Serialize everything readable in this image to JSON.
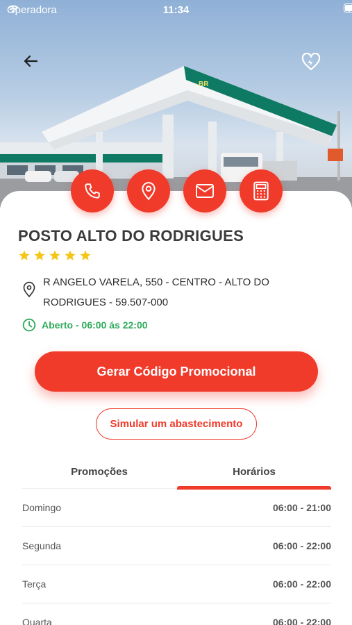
{
  "status_bar": {
    "carrier": "Operadora",
    "time": "11:34"
  },
  "station": {
    "name": "POSTO ALTO DO RODRIGUES",
    "rating": 5,
    "address": "R ANGELO VARELA, 550 - CENTRO - ALTO DO RODRIGUES - 59.507-000",
    "open_hours": "Aberto - 06:00 ás 22:00",
    "canopy_sign": "BR"
  },
  "actions": {
    "promo_button": "Gerar Código Promocional",
    "simulate_button": "Simular um abastecimento"
  },
  "tabs": [
    {
      "label": "Promoções",
      "active": false
    },
    {
      "label": "Horários",
      "active": true
    }
  ],
  "schedule": [
    {
      "day": "Domingo",
      "hours": "06:00 - 21:00"
    },
    {
      "day": "Segunda",
      "hours": "06:00 - 22:00"
    },
    {
      "day": "Terça",
      "hours": "06:00 - 22:00"
    },
    {
      "day": "Quarta",
      "hours": "06:00 - 22:00"
    }
  ],
  "colors": {
    "accent": "#f03a2a",
    "open": "#2eab5a",
    "text": "#3a3a3a"
  },
  "icons": [
    "back-arrow-icon",
    "heart-icon",
    "phone-icon",
    "location-pin-icon",
    "mail-icon",
    "calculator-icon",
    "clock-icon",
    "star-icon"
  ]
}
